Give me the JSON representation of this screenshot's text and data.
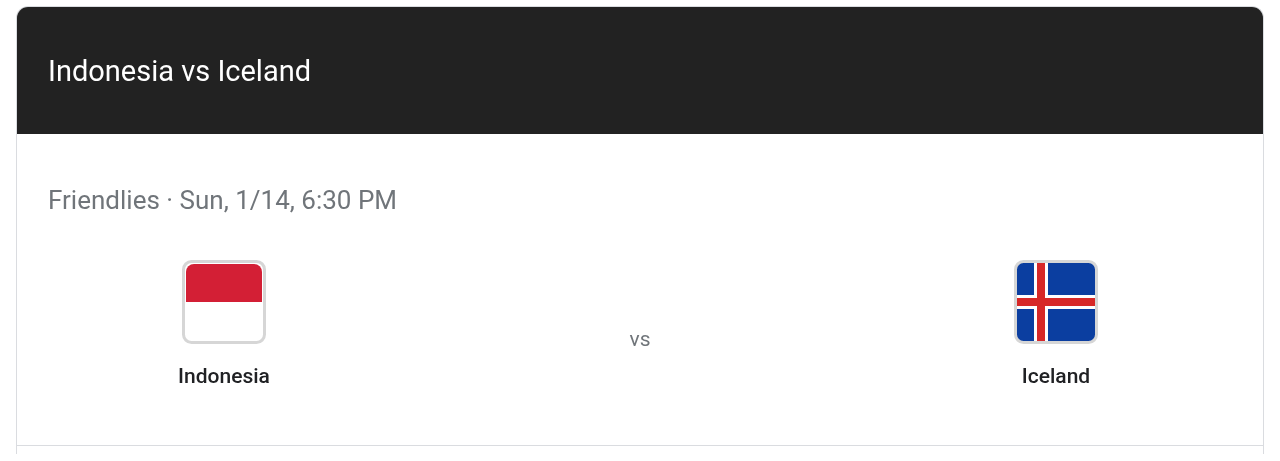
{
  "title": "Indonesia vs Iceland",
  "match_info": "Friendlies · Sun, 1/14, 6:30 PM",
  "teams": [
    {
      "name": "Indonesia",
      "kind": "bicolor"
    },
    {
      "name": "Iceland",
      "kind": "nordic-cross"
    }
  ],
  "separator": "vs"
}
